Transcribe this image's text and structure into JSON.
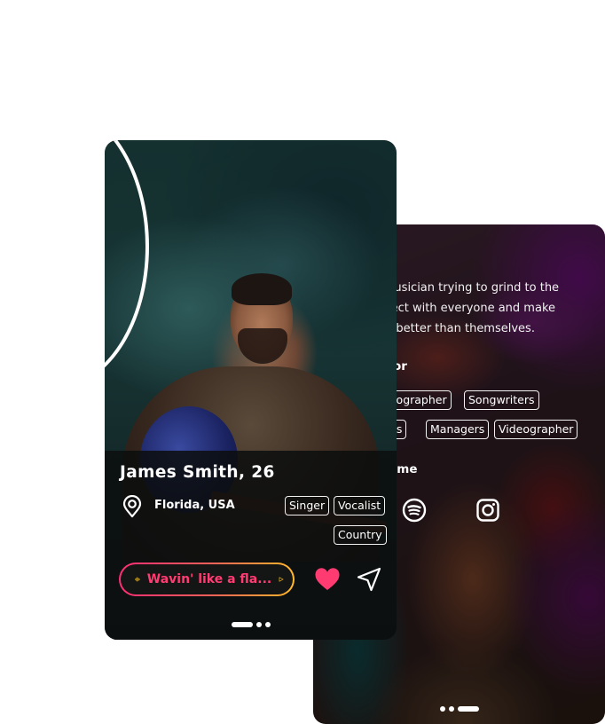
{
  "profiles": {
    "front": {
      "name_age": "James Smith, 26",
      "location": "Florida, USA",
      "tags": [
        "Singer",
        "Vocalist",
        "Country"
      ],
      "song": {
        "title": "Wavin' like a fla...",
        "play_icon": "play-icon",
        "audio_icon": "soundwave-icon"
      },
      "actions": {
        "like_icon": "heart-icon",
        "share_icon": "send-icon"
      },
      "pager": {
        "total": 3,
        "active": 1
      },
      "colors": {
        "accent_pink": "#ff2d74",
        "accent_yellow": "#ffc21a",
        "heart": "#ff3b72"
      }
    },
    "back": {
      "bio_lines": [
        "ew musician trying to grind to the",
        "connect with everyone and make",
        "be better than themselves."
      ],
      "looking_for_title": "or",
      "looking_for_tags": [
        "otographer",
        "Songwriters",
        "nts",
        "Managers",
        "Videographer"
      ],
      "connect_title": "h me",
      "socials": [
        "spotify-icon",
        "instagram-icon"
      ],
      "pager": {
        "total": 3,
        "active": 3
      }
    }
  }
}
